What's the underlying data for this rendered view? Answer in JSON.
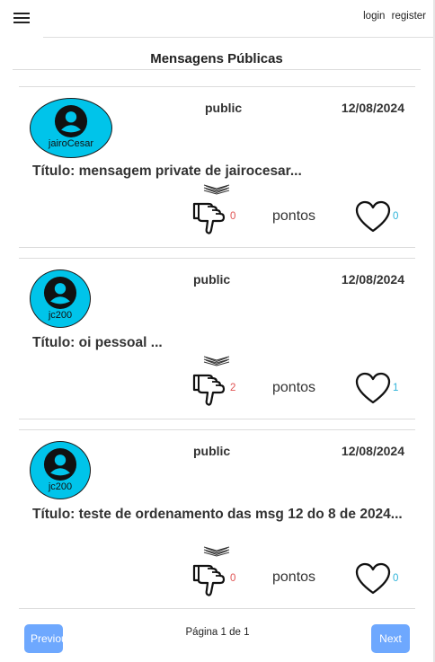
{
  "nav": {
    "login": "login",
    "register": "register"
  },
  "page_title": "Mensagens Públicas",
  "messages": [
    {
      "author": "jairoCesar",
      "visibility": "public",
      "date": "12/08/2024",
      "title": "Título: mensagem private de jairocesar...",
      "dislikes": "0",
      "points_label": "pontos",
      "likes": "0"
    },
    {
      "author": "jc200",
      "visibility": "public",
      "date": "12/08/2024",
      "title": "Título: oi pessoal ...",
      "dislikes": "2",
      "points_label": "pontos",
      "likes": "1"
    },
    {
      "author": "jc200",
      "visibility": "public",
      "date": "12/08/2024",
      "title": "Título: teste de ordenamento das msg 12 do 8 de 2024...",
      "dislikes": "0",
      "points_label": "pontos",
      "likes": "0"
    }
  ],
  "pagination": {
    "previous": "Previous",
    "info": "Página 1 de 1",
    "next": "Next"
  },
  "colors": {
    "avatar_bg": "#00c4ea",
    "button_bg": "#6ea8fe",
    "dislike_count": "#e05252",
    "like_count": "#2fb3d9"
  },
  "icons": {
    "menu": "hamburger-menu-icon",
    "avatar": "user-circle-icon",
    "expand": "chevron-expand-icon",
    "dislike": "thumbs-down-icon",
    "like": "heart-icon"
  }
}
